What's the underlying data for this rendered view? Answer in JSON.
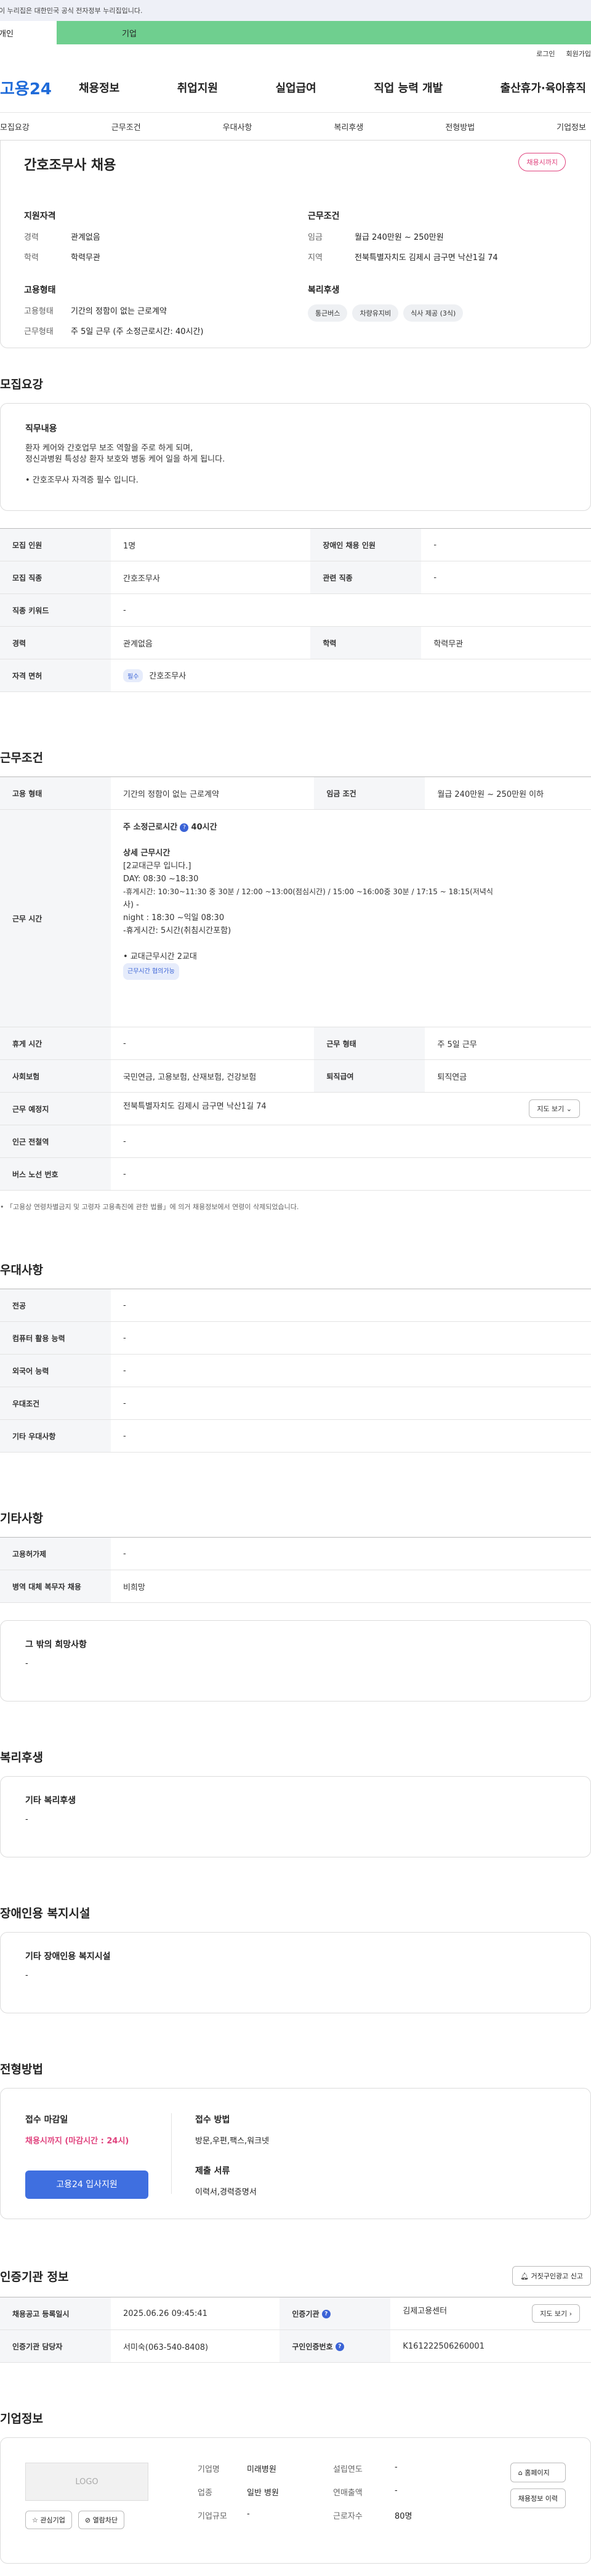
{
  "gov_banner": "이 누리집은 대한민국 공식 전자정부 누리집입니다.",
  "tabs": [
    "개인",
    "기업"
  ],
  "util": [
    "로그인",
    "회원가입"
  ],
  "logo": {
    "main": "고용24"
  },
  "gnb": [
    "채용정보",
    "취업지원",
    "실업급여",
    "직업 능력 개발",
    "출산휴가·육아휴직"
  ],
  "subnav": [
    "모집요강",
    "근무조건",
    "우대사항",
    "복리후생",
    "전형방법",
    "기업정보"
  ],
  "summary": {
    "title": "간호조무사 채용",
    "status": "채용시까지",
    "qual_title": "지원자격",
    "qual": [
      {
        "k": "경력",
        "v": "관계없음"
      },
      {
        "k": "학력",
        "v": "학력무관"
      }
    ],
    "cond_title": "근무조건",
    "cond": [
      {
        "k": "임금",
        "v": "월급 240만원 ~ 250만원"
      },
      {
        "k": "지역",
        "v": "전북특별자치도 김제시 금구면 낙산1길 74"
      }
    ],
    "emp_title": "고용형태",
    "emp": [
      {
        "k": "고용형태",
        "v": "기간의 정함이 없는 근로계약"
      },
      {
        "k": "근무형태",
        "v": "주 5일 근무 (주 소정근로시간: 40시간)"
      }
    ],
    "welfare_title": "복리후생",
    "welfare_chips": [
      "통근버스",
      "차량유지비",
      "식사 제공 (3식)"
    ]
  },
  "recruit": {
    "title": "모집요강",
    "duty_title": "직무내용",
    "duty_lines": [
      "환자 케어와 간호업무 보조 역할을 주로 하게 되며,",
      "정신과병원 특성상 환자 보호와 병동 케어 일을 하게 됩니다."
    ],
    "duty_req": "• 간호조무사 자격증 필수 입니다.",
    "rows": [
      {
        "h1": "모집 인원",
        "v1": "1명",
        "h2": "장애인 채용 인원",
        "v2": "-"
      },
      {
        "h1": "모집 직종",
        "v1": "간호조무사",
        "h2": "관련 직종",
        "v2": "-"
      },
      {
        "h1": "직종 키워드",
        "v1": "-"
      },
      {
        "h1": "경력",
        "v1": "관계없음",
        "h2": "학력",
        "v2": "학력무관"
      }
    ],
    "license_h": "자격 면허",
    "license_badge": "필수",
    "license_v": "간호조무사"
  },
  "conditions": {
    "title": "근무조건",
    "emp_h": "고용 형태",
    "emp_v": "기간의 정함이 없는 근로계약",
    "wage_h": "임금 조건",
    "wage_v": "월급 240만원 ~ 250만원 이하",
    "time_h": "근무 시간",
    "time_lines": {
      "weekly": "주 소정근로시간",
      "weekly_val": "40시간",
      "detail_title": "상세 근무시간",
      "l1": "[2교대근무 입니다.]",
      "l2": "DAY: 08:30 ~18:30",
      "l3": "-휴게시간: 10:30~11:30 중 30분 / 12:00 ~13:00(점심시간) / 15:00 ~16:00중 30분 / 17:15 ~ 18:15(저녁식",
      "l4": "사) -",
      "l5": "night : 18:30 ~익일 08:30",
      "l6": "-휴게시간: 5시간(취침시간포함)",
      "l7": "• 교대근무시간 2교대",
      "badge": "근무시간 협의가능"
    },
    "rest_h": "휴게 시간",
    "rest_v": "-",
    "form_h": "근무 형태",
    "form_v": "주 5일 근무",
    "ins_h": "사회보험",
    "ins_v": "국민연금, 고용보험, 산재보험, 건강보험",
    "ret_h": "퇴직급여",
    "ret_v": "퇴직연금",
    "place_h": "근무 예정지",
    "place_v": "전북특별자치도 김제시 금구면 낙산1길 74",
    "map_btn": "지도 보기",
    "subway_h": "인근 전철역",
    "subway_v": "-",
    "bus_h": "버스 노선 번호",
    "bus_v": "-",
    "note": "• 「고용상 연령차별금지 및 고령자 고용촉진에 관한 법률」에 의거 채용정보에서 연령이 삭제되었습니다."
  },
  "prefer": {
    "title": "우대사항",
    "rows": [
      {
        "h": "전공",
        "v": "-"
      },
      {
        "h": "컴퓨터 활용 능력",
        "v": "-"
      },
      {
        "h": "외국어 능력",
        "v": "-"
      },
      {
        "h": "우대조건",
        "v": "-"
      },
      {
        "h": "기타 우대사항",
        "v": "-"
      }
    ]
  },
  "etc": {
    "title": "기타사항",
    "rows": [
      {
        "h": "고용허가제",
        "v": "-"
      },
      {
        "h": "병역 대체 복무자 채용",
        "v": "비희망"
      }
    ],
    "wish_title": "그 밖의 희망사항",
    "wish_v": "-"
  },
  "welfare": {
    "title": "복리후생",
    "box_title": "기타 복리후생",
    "box_v": "-"
  },
  "disabled": {
    "title": "장애인용 복지시설",
    "box_title": "기타 장애인용 복지시설",
    "box_v": "-"
  },
  "process": {
    "title": "전형방법",
    "deadline_h": "접수 마감일",
    "deadline_v": "채용시까지 (마감시간 : 24시)",
    "apply_btn": "고용24 입사지원",
    "method_h": "접수 방법",
    "method_v": "방문,우편,팩스,워크넷",
    "docs_h": "제출 서류",
    "docs_v": "이력서,경력증명서"
  },
  "cert": {
    "title": "인증기관 정보",
    "report_btn": "거짓구인광고 신고",
    "reg_h": "채용공고 등록일시",
    "reg_v": "2025.06.26 09:45:41",
    "org_h": "인증기관",
    "org_v": "김제고용센터",
    "map_btn": "지도 보기",
    "mgr_h": "인증기관 담당자",
    "mgr_v": "서미숙(063-540-8408)",
    "no_h": "구인인증번호",
    "no_v": "K161222506260001"
  },
  "company": {
    "title": "기업정보",
    "logo": "LOGO",
    "fav_btn": "관심기업",
    "block_btn": "열람차단",
    "info": [
      {
        "k": "기업명",
        "v": "미래병원",
        "k2": "설립연도",
        "v2": "-"
      },
      {
        "k": "업종",
        "v": "일반 병원",
        "k2": "연매출액",
        "v2": "-"
      },
      {
        "k": "기업규모",
        "v": "-",
        "k2": "근로자수",
        "v2": "80명"
      }
    ],
    "home_btn": "홈페이지",
    "more_btn": "채용정보 이력"
  }
}
